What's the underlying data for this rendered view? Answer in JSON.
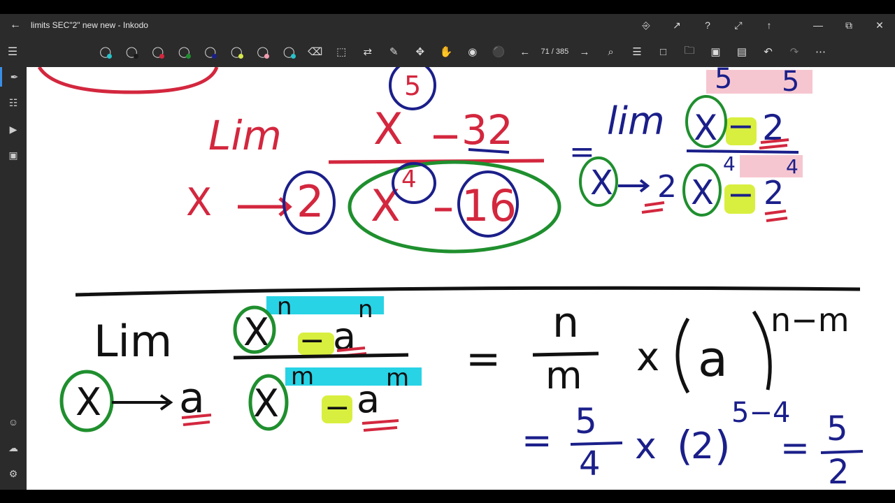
{
  "window": {
    "title": "limits SEC\"2\" new new - Inkodo",
    "back_icon": "back-arrow-icon"
  },
  "toolbar": {
    "pens": [
      {
        "color": "#27c2c7"
      },
      {
        "color": "#1a1a1a"
      },
      {
        "color": "#d3273e"
      },
      {
        "color": "#1f8f2e"
      },
      {
        "color": "#1b1f8a"
      },
      {
        "color": "#d6e84a"
      },
      {
        "color": "#f29bb0"
      },
      {
        "color": "#27c2c7"
      }
    ],
    "page_indicator": "71 / 385"
  },
  "ink_colors": {
    "red": "#d3273e",
    "green": "#1f8f2e",
    "navy": "#1b1f8a",
    "black": "#111111",
    "yellow": "#d9ef3f",
    "pink": "#f6c6d0",
    "cyan": "#28d3e6"
  },
  "canvas": {
    "top_problem": {
      "lim": "Lim",
      "approach_var": "X",
      "approach_value": "2",
      "numerator": "X",
      "numerator_const": "32",
      "exp_annotation": "5",
      "denominator_var": "X",
      "denominator_exp": "4",
      "denominator_const": "16"
    },
    "top_rewrite": {
      "equals": "=",
      "lim": "lim",
      "approach_var": "X",
      "approach_value": "2",
      "num_var": "X",
      "num_minus": "−",
      "num_base": "2",
      "num_exp_left": "5",
      "num_exp_right": "5",
      "den_var": "X",
      "den_minus": "−",
      "den_base": "2",
      "den_exp_left": "4",
      "den_exp_right": "4"
    },
    "formula": {
      "lim": "Lim",
      "approach_var": "X",
      "approach_value": "a",
      "num_var": "X",
      "num_exp_left": "n",
      "num_minus": "−",
      "num_base": "a",
      "num_exp_right": "n",
      "den_var": "X",
      "den_exp_left": "m",
      "den_minus": "−",
      "den_base": "a",
      "den_exp_right": "m",
      "equals": "=",
      "frac_num": "n",
      "frac_den": "m",
      "times": "x",
      "base": "a",
      "power": "n−m"
    },
    "solution": {
      "equals1": "=",
      "frac_num": "5",
      "frac_den": "4",
      "times": "x",
      "base": "2",
      "power": "5−4",
      "equals2": "=",
      "result_num": "5",
      "result_den": "2"
    }
  }
}
